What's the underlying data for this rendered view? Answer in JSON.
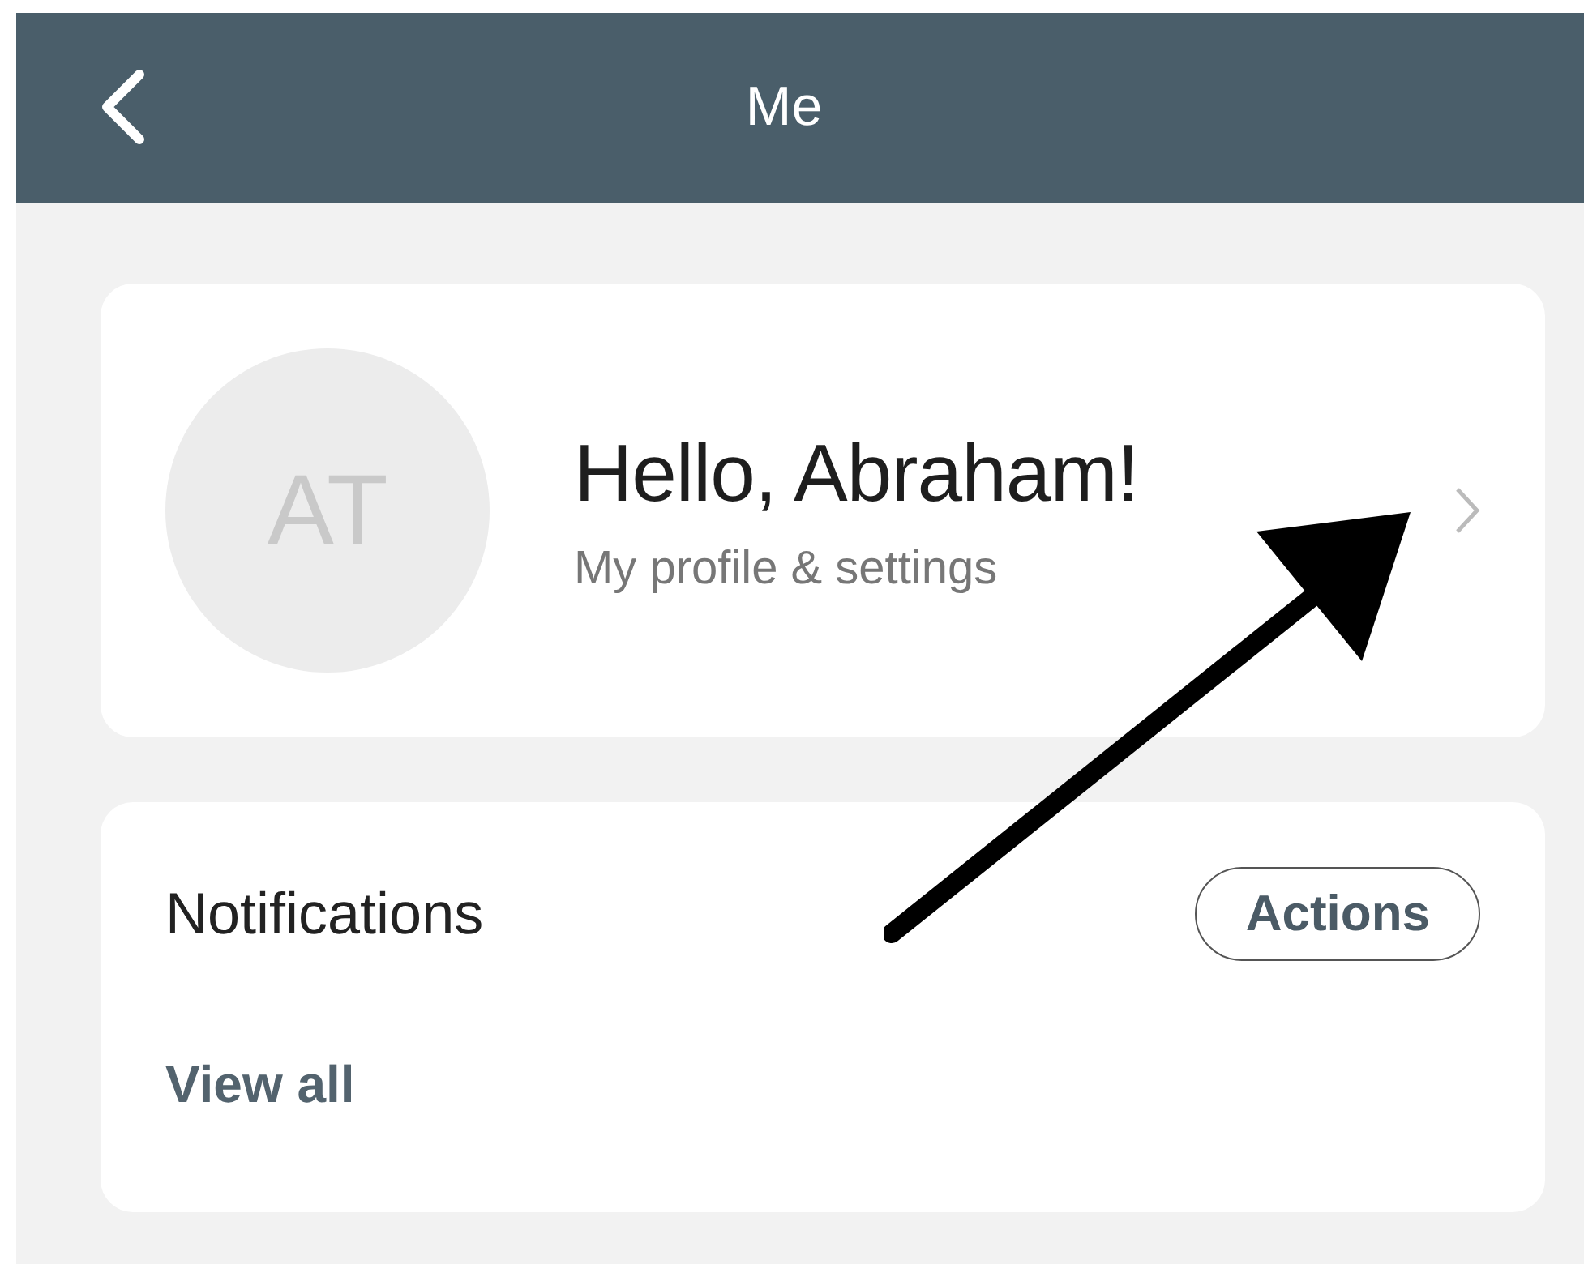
{
  "header": {
    "title": "Me"
  },
  "profile": {
    "initials": "AT",
    "greeting": "Hello, Abraham!",
    "subtitle": "My profile & settings"
  },
  "notifications": {
    "title": "Notifications",
    "action": "Actions",
    "link": "View all"
  }
}
